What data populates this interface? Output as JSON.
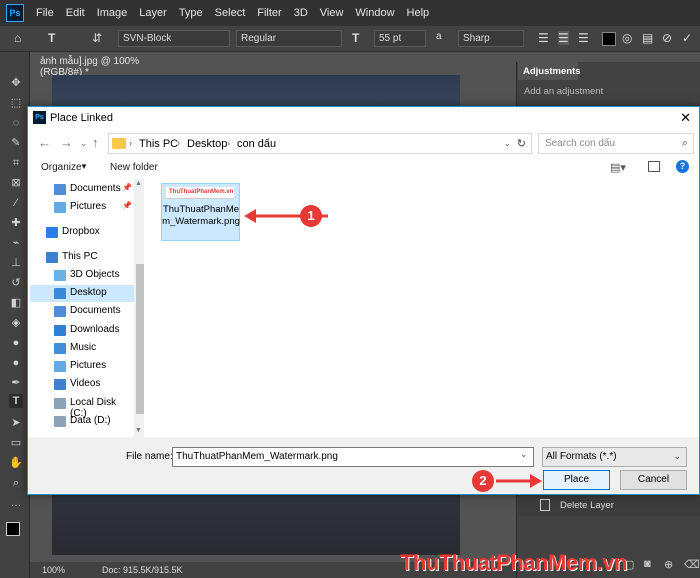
{
  "photoshop": {
    "menu": [
      "File",
      "Edit",
      "Image",
      "Layer",
      "Type",
      "Select",
      "Filter",
      "3D",
      "View",
      "Window",
      "Help"
    ],
    "options": {
      "font_family": "SVN-Block",
      "font_style": "Regular",
      "font_size": "55 pt",
      "antialias_prefix": "a",
      "antialias": "Sharp"
    },
    "document_tab": "ảnh mẫu].jpg @ 100% (RGB/8#) *",
    "adjustments": {
      "tab": "Adjustments",
      "subtitle": "Add an adjustment"
    },
    "layers": {
      "delete_layer": "Delete Layer"
    },
    "status": {
      "zoom": "100%",
      "doc": "Doc: 915.5K/915.5K"
    }
  },
  "dialog": {
    "title": "Place Linked",
    "breadcrumb": [
      "This PC",
      "Desktop",
      "con dấu"
    ],
    "search_placeholder": "Search con dấu",
    "commands": {
      "organize": "Organize",
      "new_folder": "New folder"
    },
    "nav_items": [
      {
        "label": "Documents",
        "color": "#4f8ed6"
      },
      {
        "label": "Pictures",
        "color": "#63a9e6"
      },
      {
        "label": "Dropbox",
        "color": "#2b7de9"
      },
      {
        "label": "This PC",
        "color": "#3a7fd0"
      },
      {
        "label": "3D Objects",
        "color": "#6ab1e7"
      },
      {
        "label": "Desktop",
        "color": "#3a8ad8"
      },
      {
        "label": "Documents",
        "color": "#4f8ed6"
      },
      {
        "label": "Downloads",
        "color": "#2f7fd4"
      },
      {
        "label": "Music",
        "color": "#3f8fd9"
      },
      {
        "label": "Pictures",
        "color": "#63a9e6"
      },
      {
        "label": "Videos",
        "color": "#3f7fcf"
      },
      {
        "label": "Local Disk (C:)",
        "color": "#8aa3b8"
      },
      {
        "label": "Data (D:)",
        "color": "#8aa3b8"
      }
    ],
    "file": {
      "name": "ThuThuatPhanMem_Watermark.png",
      "thumb_text": "ThuThuatPhanMem.vn"
    },
    "file_name_label": "File name:",
    "file_name_value": "ThuThuatPhanMem_Watermark.png",
    "format": "All Formats (*.*)",
    "place": "Place",
    "cancel": "Cancel"
  },
  "callouts": {
    "one": "1",
    "two": "2"
  },
  "watermark": "ThuThuatPhanMem.vn"
}
